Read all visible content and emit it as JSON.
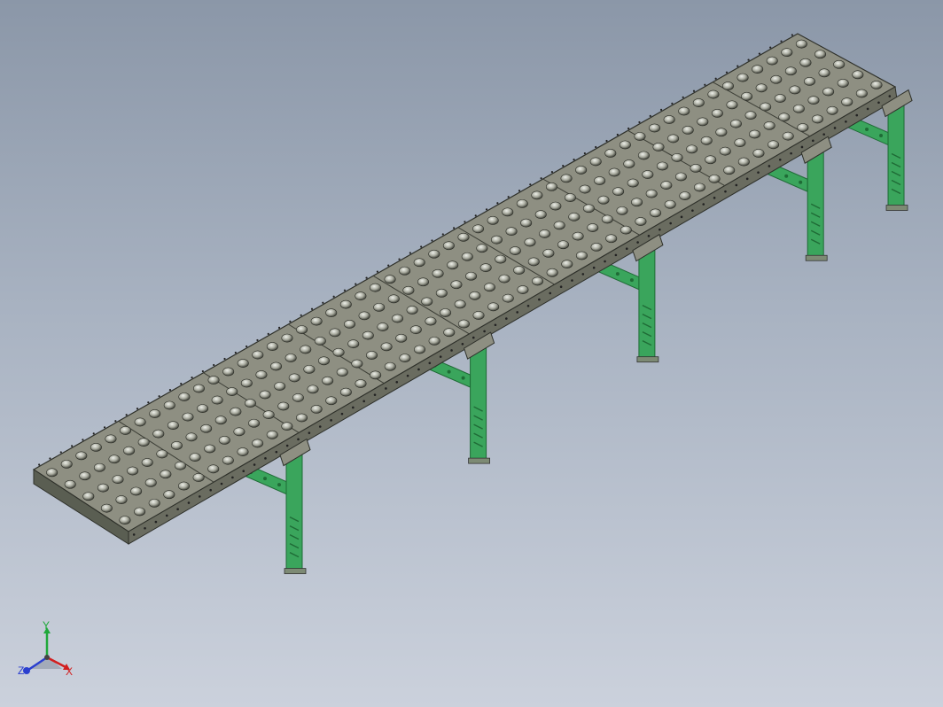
{
  "viewport": {
    "background_top": "#8b97a8",
    "background_bottom": "#cbd1dc"
  },
  "model": {
    "frame_color": "#5a5e52",
    "deck_color": "#8e8f82",
    "ball_color": "#c9cbc2",
    "stand_color": "#3aa55c",
    "stand_dark": "#1f6b36",
    "deck_sections": 9,
    "stand_count": 5
  },
  "triad": {
    "x_label": "X",
    "y_label": "Y",
    "z_label": "Z",
    "x_color": "#d21f1f",
    "y_color": "#1fa83a",
    "z_color": "#2a3fcf",
    "icon": "view-orientation-triad-icon"
  }
}
